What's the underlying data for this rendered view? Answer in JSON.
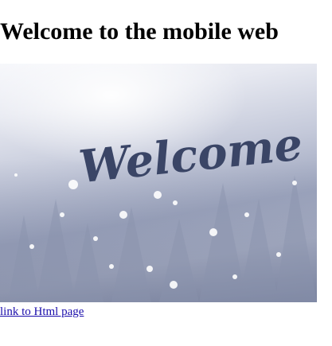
{
  "page": {
    "title": "Welcome to the mobile web"
  },
  "hero_image": {
    "script_text": "Welcome"
  },
  "link": {
    "label": "link to Html page"
  },
  "colors": {
    "link": "#1a0dab",
    "script_text": "#3a4566"
  }
}
